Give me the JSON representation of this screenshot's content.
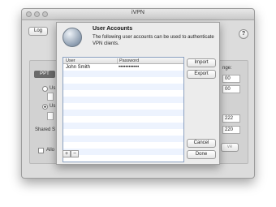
{
  "window": {
    "title": "iVPN"
  },
  "toolbar": {
    "log_label": "Log",
    "help_label": "?"
  },
  "background": {
    "tab_label": "PPT",
    "radio1_label": "Us",
    "radio2_label": "Us",
    "shared_label": "Shared S",
    "allow_label": "Allo",
    "range_label": "nge:",
    "field1": "00",
    "field2": "00",
    "ip1": "222",
    "ip2": "220",
    "ve_label": "ve"
  },
  "sheet": {
    "title": "User Accounts",
    "description": "The following user accounts can be used to authenticate VPN clients.",
    "columns": [
      "User",
      "Password"
    ],
    "rows": [
      {
        "user": "John Smith",
        "password": "••••••••••••"
      }
    ],
    "buttons": {
      "import": "Import",
      "export": "Export",
      "cancel": "Cancel",
      "done": "Done",
      "add": "+",
      "remove": "−"
    }
  }
}
